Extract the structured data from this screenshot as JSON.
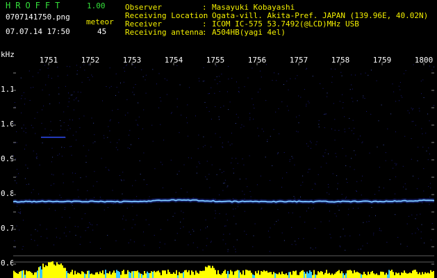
{
  "app": {
    "logo": "HROFFT",
    "version": "1.00"
  },
  "file": {
    "name": "0707141750.png",
    "datetime": "07.07.14 17:50"
  },
  "meteor": {
    "label": "meteor",
    "count": "45"
  },
  "info": [
    {
      "key": "Observer",
      "value": "Masayuki Kobayashi"
    },
    {
      "key": "Receiving Location",
      "value": "Ogata-vill. Akita-Pref. JAPAN (139.96E, 40.02N)"
    },
    {
      "key": "Receiver",
      "value": "ICOM IC-575 53.7492(@LCD)MHz USB"
    },
    {
      "key": "Receiving antenna",
      "value": "A504HB(yagi 4el)"
    }
  ],
  "axis": {
    "unit": "kHz",
    "y_ticks": [
      "1.1",
      "1.0",
      "0.9",
      "0.8",
      "0.7",
      "0.6"
    ],
    "x_ticks": [
      "1751",
      "1752",
      "1753",
      "1754",
      "1755",
      "1756",
      "1757",
      "1758",
      "1759",
      "1800"
    ]
  },
  "chart_data": {
    "type": "heatmap",
    "x": [
      "1751",
      "1752",
      "1753",
      "1754",
      "1755",
      "1756",
      "1757",
      "1758",
      "1759",
      "1800"
    ],
    "ylabel": "kHz",
    "ylim": [
      0.6,
      1.16
    ],
    "carrier_khz": 0.78,
    "colors": {
      "background": "#000000",
      "noise": "#1a1a7a",
      "signal": "#5fa8ff",
      "level_bars": "#ffff00",
      "level_cyan": "#38c8ff"
    }
  }
}
